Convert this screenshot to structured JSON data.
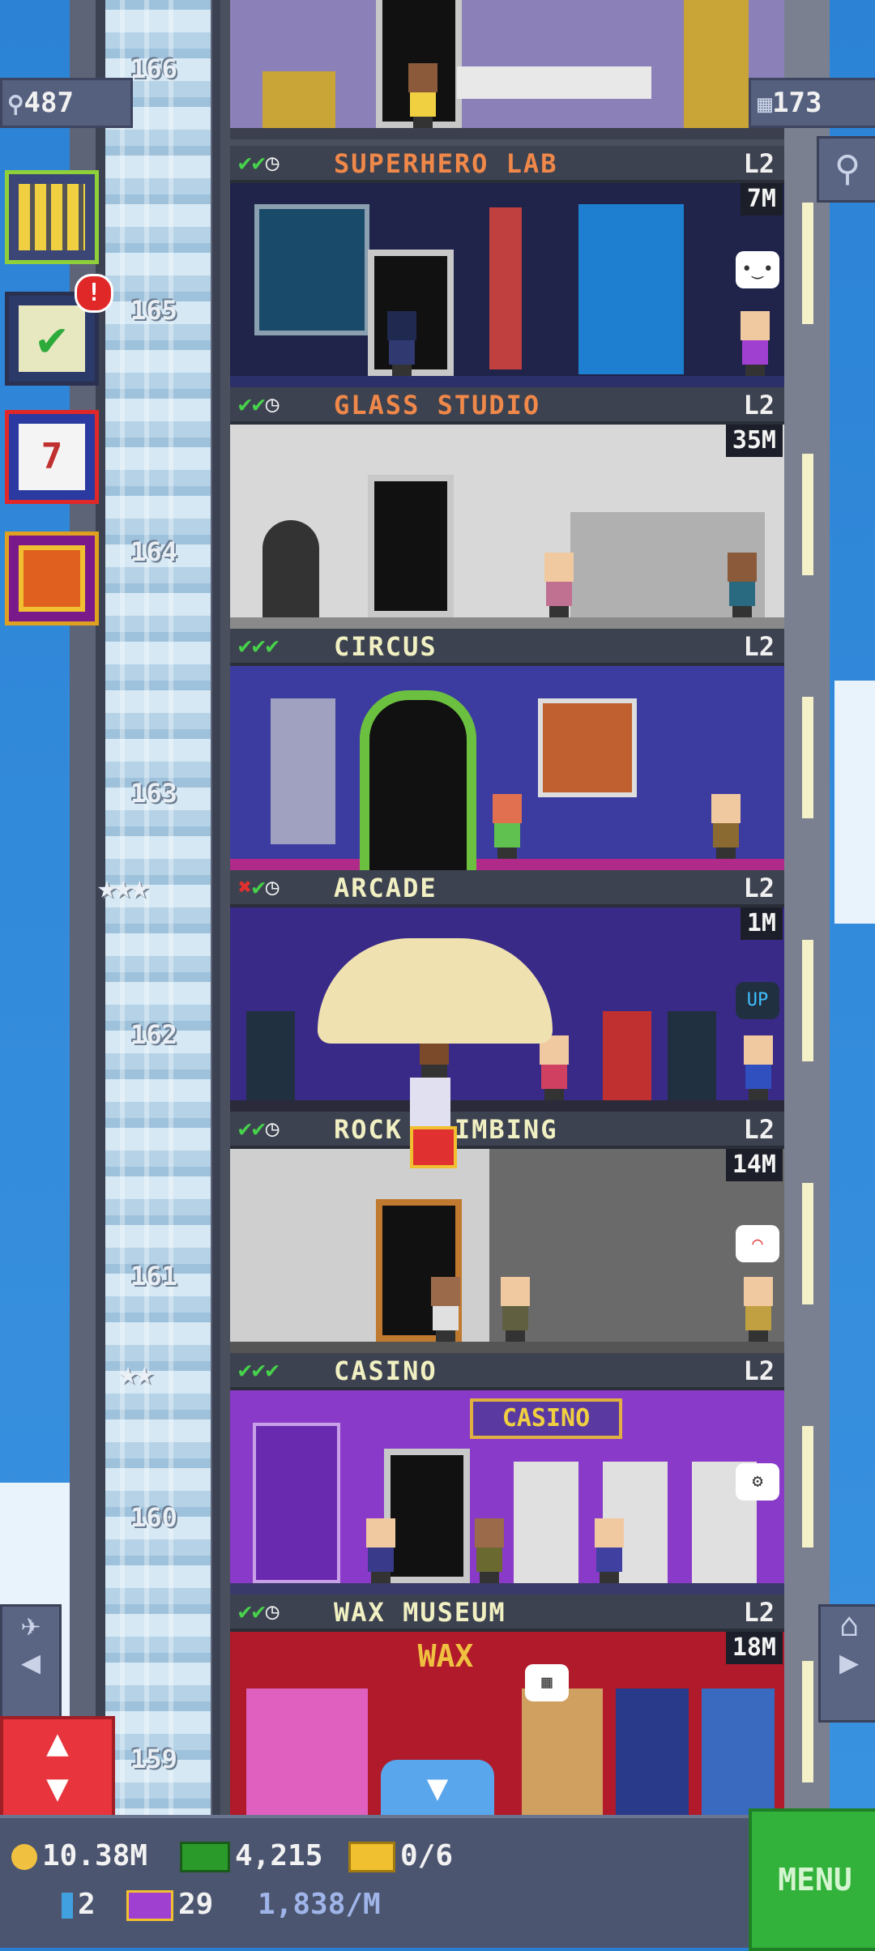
{
  "hud": {
    "population": "487",
    "floor_count": "173"
  },
  "side_buttons": {
    "mission_badge": "!"
  },
  "floors": [
    {
      "number": "166",
      "name": "",
      "level": "",
      "timer": "",
      "checks": []
    },
    {
      "number": "165",
      "name": "SUPERHERO LAB",
      "level": "L2",
      "timer": "7M",
      "checks": [
        "ok",
        "ok",
        "clock"
      ]
    },
    {
      "number": "164",
      "name": "GLASS STUDIO",
      "level": "L2",
      "timer": "35M",
      "checks": [
        "ok",
        "ok",
        "clock"
      ]
    },
    {
      "number": "163",
      "name": "CIRCUS",
      "level": "L2",
      "timer": "",
      "checks": [
        "ok",
        "ok",
        "ok"
      ]
    },
    {
      "number": "162",
      "name": "ARCADE",
      "level": "L2",
      "timer": "1M",
      "checks": [
        "x",
        "ok",
        "clock"
      ]
    },
    {
      "number": "161",
      "name": "ROCK CLIMBING",
      "level": "L2",
      "timer": "14M",
      "checks": [
        "ok",
        "ok",
        "clock"
      ]
    },
    {
      "number": "160",
      "name": "CASINO",
      "level": "L2",
      "timer": "",
      "checks": [
        "ok",
        "ok",
        "ok"
      ]
    },
    {
      "number": "159",
      "name": "WAX MUSEUM",
      "level": "L2",
      "timer": "18M",
      "checks": [
        "ok",
        "ok",
        "clock"
      ]
    }
  ],
  "signs": {
    "casino": "CASINO",
    "wax": "WAX",
    "arcade_bubble": "UP"
  },
  "bottom_bar": {
    "coins": "10.38M",
    "bux": "4,215",
    "tickets": "0/6",
    "keys": "2",
    "golden_tickets": "29",
    "rate": "1,838/M",
    "menu_label": "MENU"
  },
  "colors": {
    "check_ok": "#46d24a",
    "check_x": "#e03030",
    "menu_green": "#33b23b",
    "elevator_red": "#e8343c"
  }
}
